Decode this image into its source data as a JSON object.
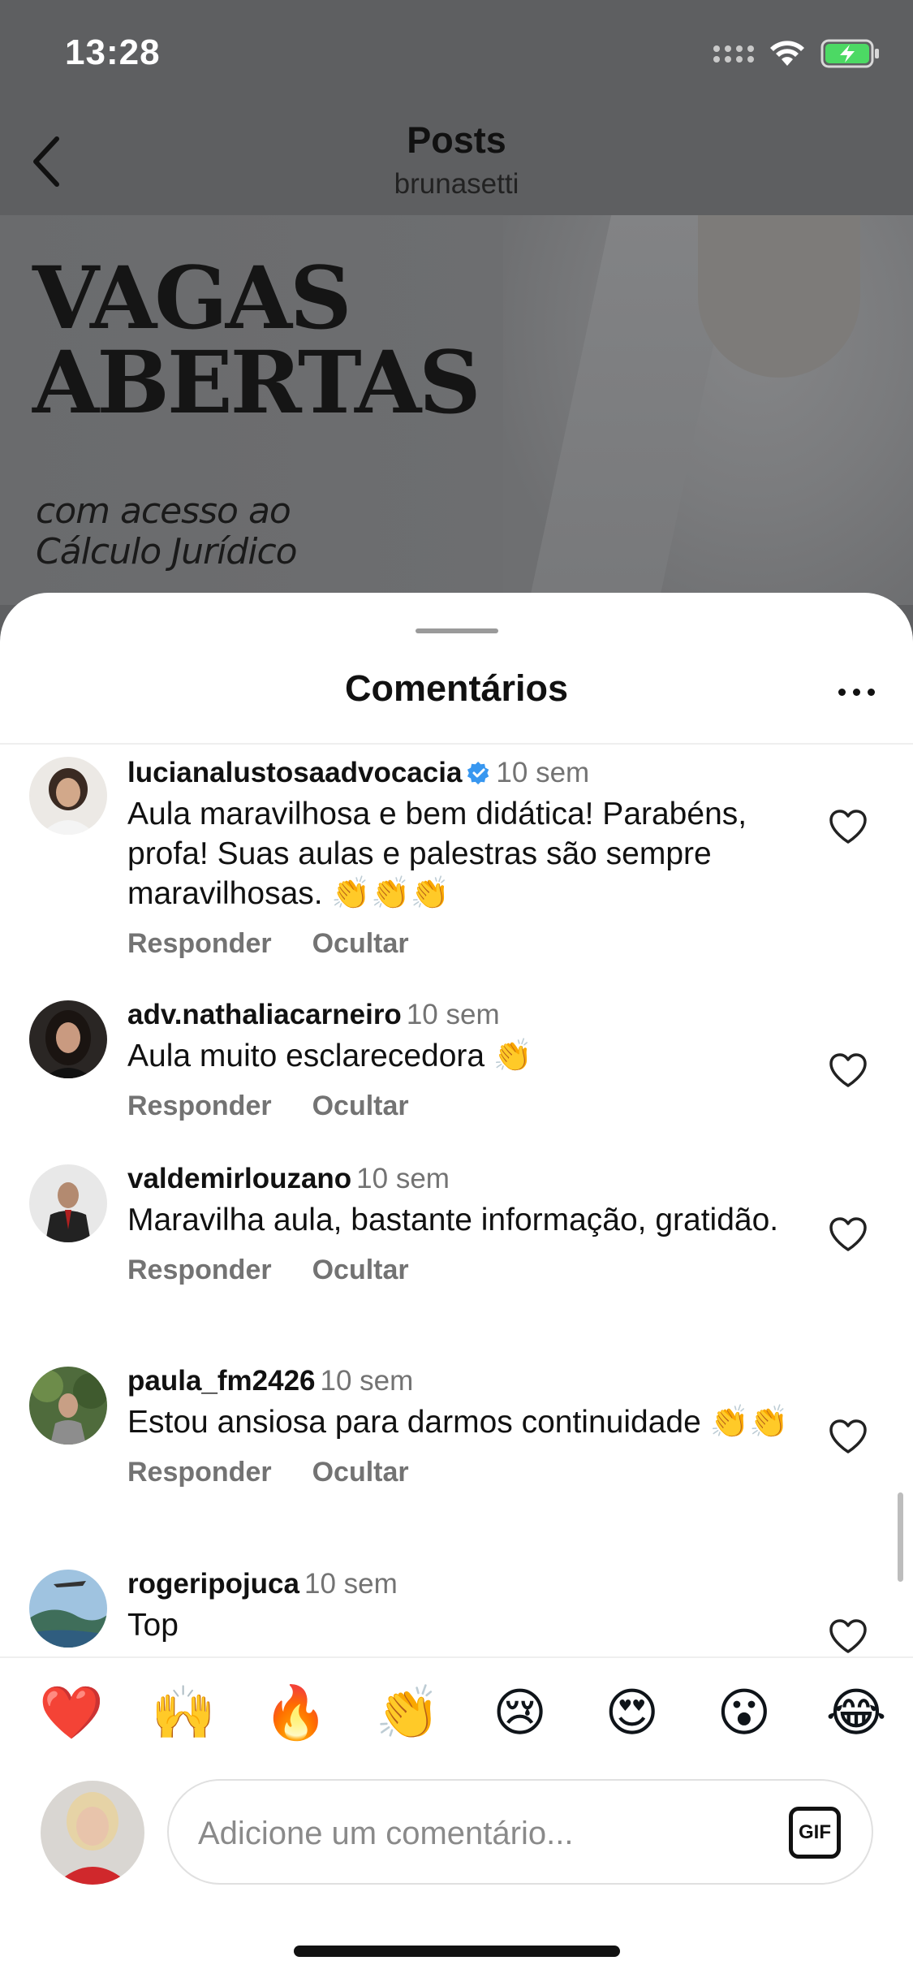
{
  "status_bar": {
    "time": "13:28"
  },
  "header": {
    "title": "Posts",
    "subtitle": "brunasetti"
  },
  "post": {
    "headline_line1": "VAGAS",
    "headline_line2": "ABERTAS",
    "sub_line1": "com acesso ao",
    "sub_line2": "Cálculo Jurídico"
  },
  "sheet": {
    "title": "Comentários"
  },
  "comment_actions": {
    "reply": "Responder",
    "hide": "Ocultar"
  },
  "comments": [
    {
      "username": "lucianalustosaadvocacia",
      "verified": true,
      "time": "10 sem",
      "text": "Aula maravilhosa e bem didática! Parabéns, profa! Suas aulas e palestras são sempre maravilhosas. 👏👏👏"
    },
    {
      "username": "adv.nathaliacarneiro",
      "verified": false,
      "time": "10 sem",
      "text": "Aula muito esclarecedora 👏"
    },
    {
      "username": "valdemirlouzano",
      "verified": false,
      "time": "10 sem",
      "text": "Maravilha aula, bastante informação, gratidão."
    },
    {
      "username": "paula_fm2426",
      "verified": false,
      "time": "10 sem",
      "text": "Estou ansiosa para darmos continuidade 👏👏"
    },
    {
      "username": "rogeripojuca",
      "verified": false,
      "time": "10 sem",
      "text": "Top"
    }
  ],
  "emoji_bar": [
    "❤️",
    "🙌",
    "🔥",
    "👏",
    "😢",
    "😍",
    "😮",
    "😂"
  ],
  "comment_input": {
    "placeholder": "Adicione um comentário...",
    "gif_label": "GIF"
  },
  "colors": {
    "accent_blue": "#3897f0",
    "battery_green": "#4cd964",
    "muted_text": "#737373"
  }
}
